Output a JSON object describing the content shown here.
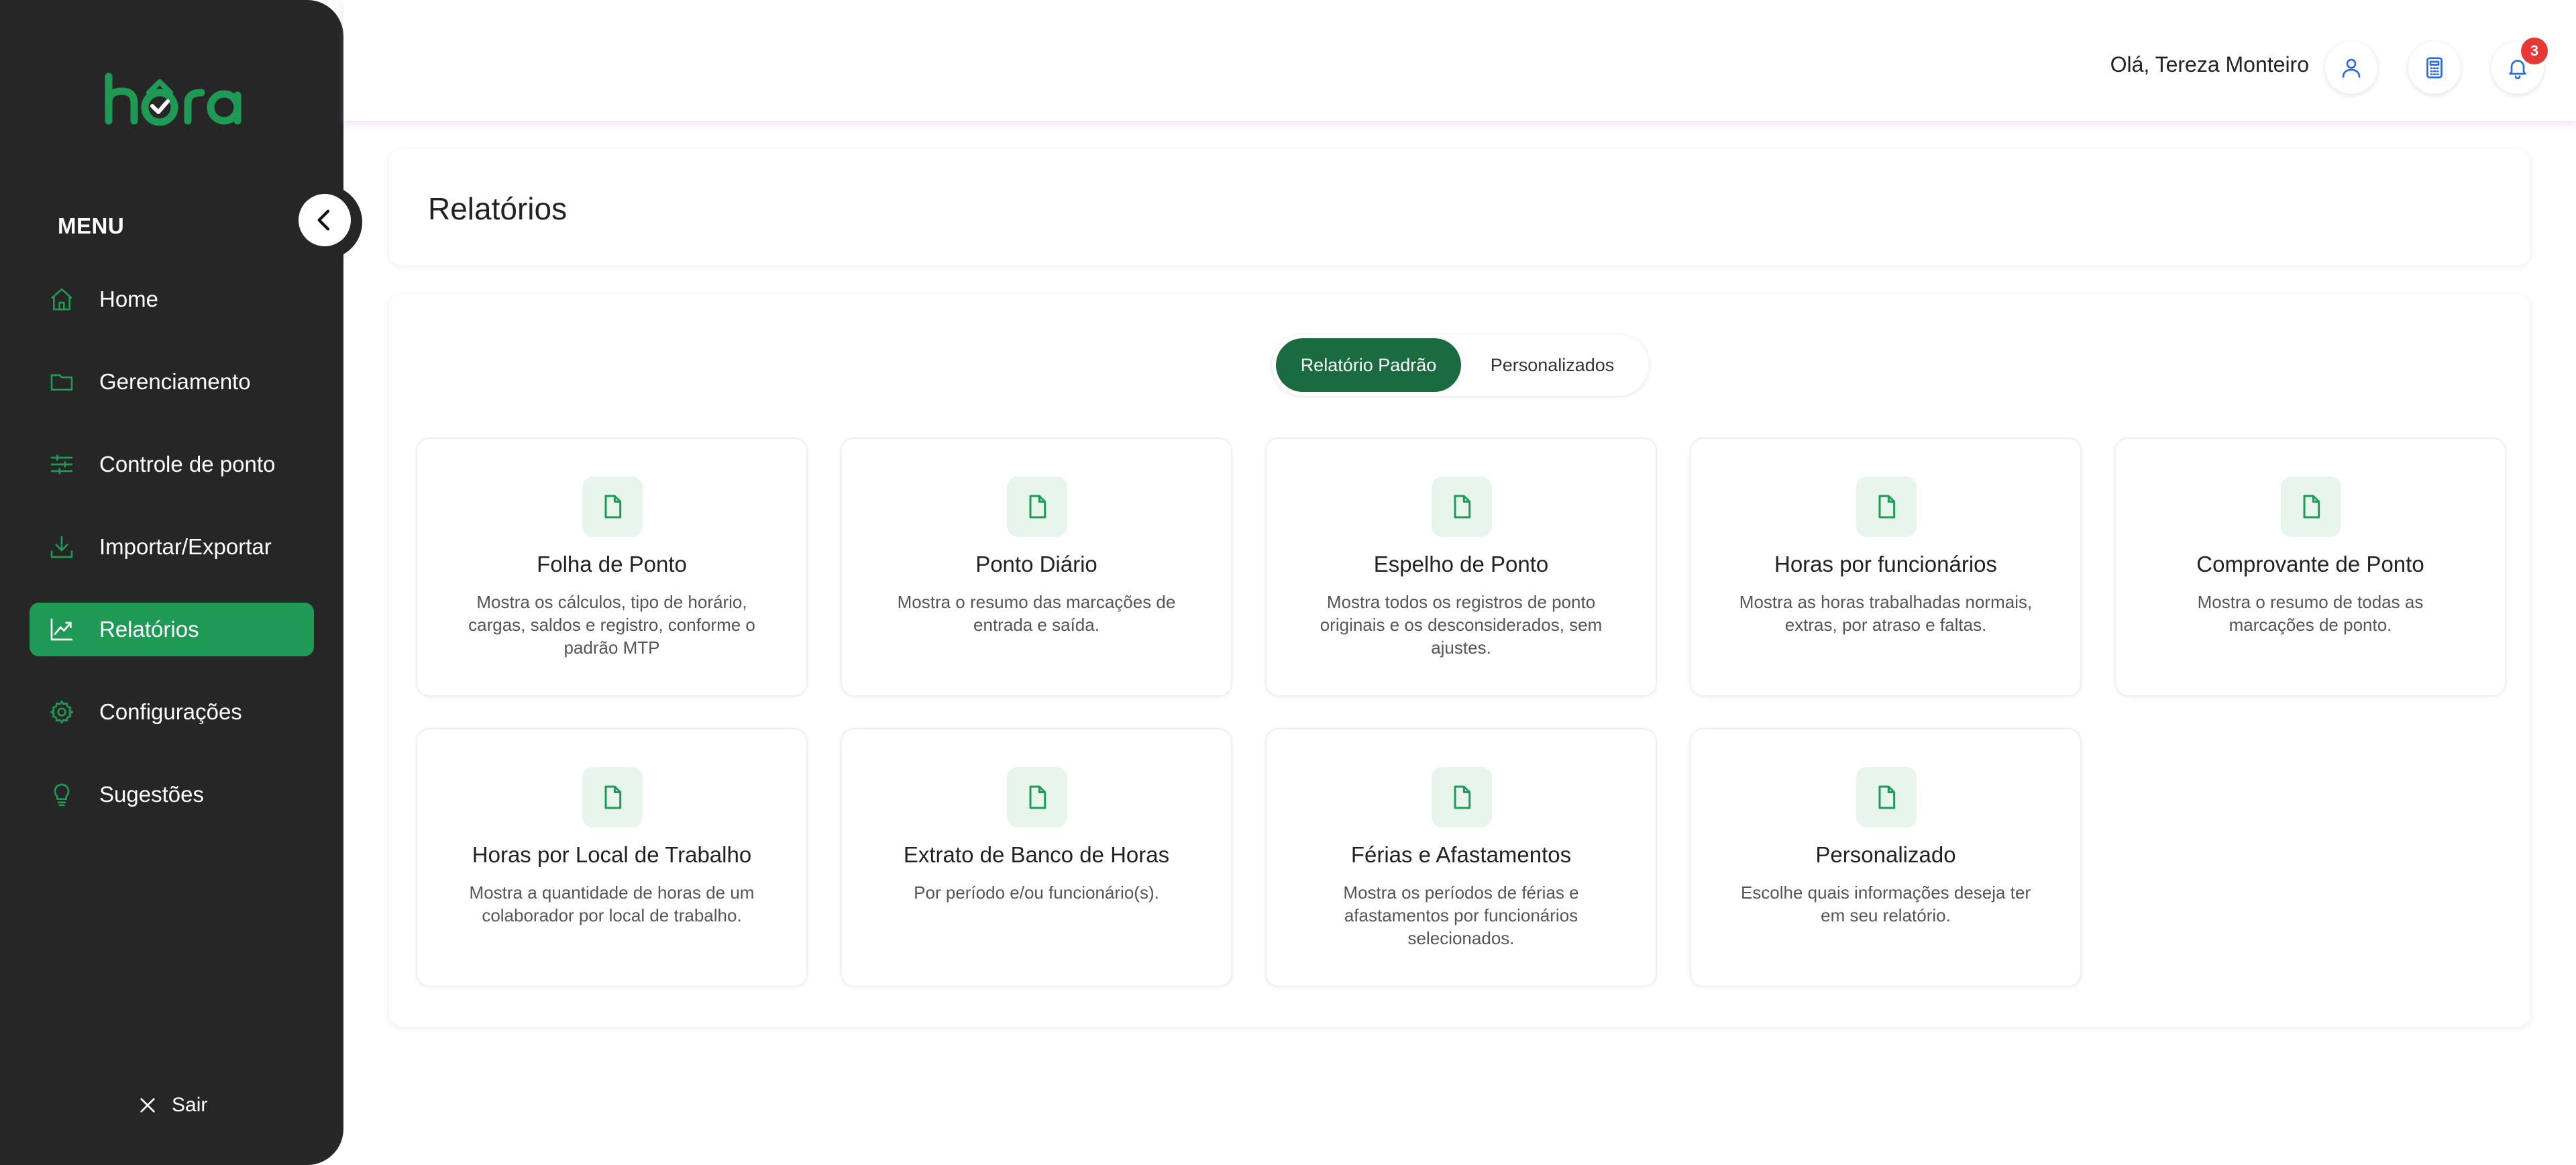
{
  "brand": {
    "logo_text": "hora",
    "accent": "#1f9a55"
  },
  "sidebar": {
    "menu_title": "MENU",
    "items": [
      {
        "label": "Home",
        "icon": "home-icon",
        "active": false
      },
      {
        "label": "Gerenciamento",
        "icon": "folder-icon",
        "active": false
      },
      {
        "label": "Controle de ponto",
        "icon": "sliders-icon",
        "active": false
      },
      {
        "label": "Importar/Exportar",
        "icon": "download-icon",
        "active": false
      },
      {
        "label": "Relatórios",
        "icon": "chart-line-icon",
        "active": true
      },
      {
        "label": "Configurações",
        "icon": "gear-icon",
        "active": false
      },
      {
        "label": "Sugestões",
        "icon": "lightbulb-icon",
        "active": false
      }
    ],
    "logout_label": "Sair"
  },
  "header": {
    "greeting": "Olá, Tereza Monteiro",
    "notification_count": "3"
  },
  "main": {
    "title": "Relatórios",
    "tabs": [
      {
        "label": "Relatório Padrão",
        "active": true
      },
      {
        "label": "Personalizados",
        "active": false
      }
    ],
    "reports": [
      {
        "title": "Folha de Ponto",
        "desc": "Mostra os cálculos, tipo de horário, cargas, saldos e registro, conforme o padrão MTP"
      },
      {
        "title": "Ponto Diário",
        "desc": "Mostra o resumo das marcações de entrada e saída."
      },
      {
        "title": "Espelho de Ponto",
        "desc": "Mostra todos os registros de ponto originais e os desconsiderados, sem ajustes."
      },
      {
        "title": "Horas por funcionários",
        "desc": "Mostra as horas trabalhadas normais, extras, por atraso e faltas."
      },
      {
        "title": "Comprovante de Ponto",
        "desc": "Mostra o resumo de todas as marcações de ponto."
      },
      {
        "title": "Horas por Local de Trabalho",
        "desc": "Mostra a quantidade de horas de um colaborador por local de trabalho."
      },
      {
        "title": "Extrato de Banco de Horas",
        "desc": "Por período e/ou funcionário(s)."
      },
      {
        "title": "Férias e Afastamentos",
        "desc": "Mostra os períodos de férias e afastamentos por funcionários selecionados."
      },
      {
        "title": "Personalizado",
        "desc": "Escolhe quais informações deseja ter em seu relatório."
      }
    ]
  }
}
